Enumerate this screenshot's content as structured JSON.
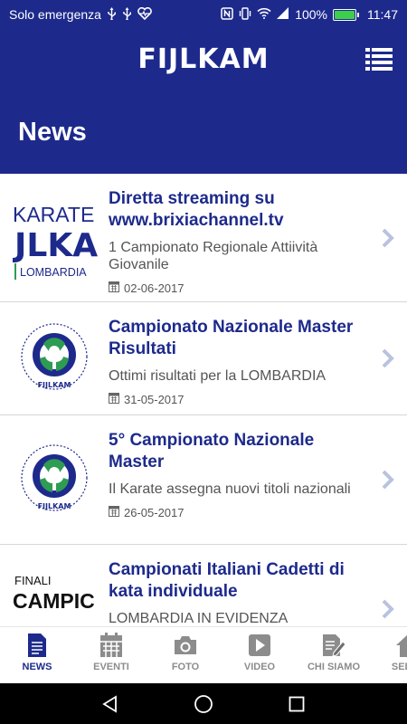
{
  "status_bar": {
    "carrier": "Solo emergenza",
    "battery_percent": "100%",
    "time": "11:47",
    "battery_level": 1.0,
    "battery_color": "#3ecf4a"
  },
  "header": {
    "logo_text": "FIJLKAM",
    "page_title": "News",
    "menu_icon": "list-menu-icon",
    "background_color": "#1d2a8c"
  },
  "news": [
    {
      "title": "Diretta streaming su www.brixiachannel.tv",
      "subtitle": "1   Campionato Regionale Attiività Giovanile",
      "date": "02-06-2017",
      "thumb": {
        "kind": "karate-lombardia",
        "line1": "KARATE",
        "line2": "JLKA",
        "line3": "LOMBARDIA"
      }
    },
    {
      "title": "Campionato Nazionale Master Risultati",
      "subtitle": "Ottimi risultati per la LOMBARDIA",
      "date": "31-05-2017",
      "thumb": {
        "kind": "fijlkam-seal",
        "caption": "FIJLKAM"
      }
    },
    {
      "title": "5° Campionato Nazionale Master",
      "subtitle": "Il Karate assegna nuovi titoli nazionali",
      "date": "26-05-2017",
      "thumb": {
        "kind": "fijlkam-seal",
        "caption": "FIJLKAM"
      }
    },
    {
      "title": "Campionati Italiani Cadetti di kata individuale",
      "subtitle": "LOMBARDIA IN EVIDENZA",
      "date": "",
      "thumb": {
        "kind": "finali",
        "line1": "FINALI",
        "line2": "CAMPIC"
      }
    }
  ],
  "bottom_nav": [
    {
      "label": "NEWS",
      "icon": "document-icon",
      "active": true
    },
    {
      "label": "EVENTI",
      "icon": "calendar-icon",
      "active": false
    },
    {
      "label": "FOTO",
      "icon": "camera-icon",
      "active": false
    },
    {
      "label": "VIDEO",
      "icon": "play-icon",
      "active": false
    },
    {
      "label": "CHI SIAMO",
      "icon": "edit-document-icon",
      "active": false
    },
    {
      "label": "SEDI A",
      "icon": "home-icon",
      "active": false
    }
  ],
  "colors": {
    "brand_blue": "#1d2a8c",
    "chevron": "#b9c3df",
    "inactive_gray": "#8c8c8c"
  }
}
